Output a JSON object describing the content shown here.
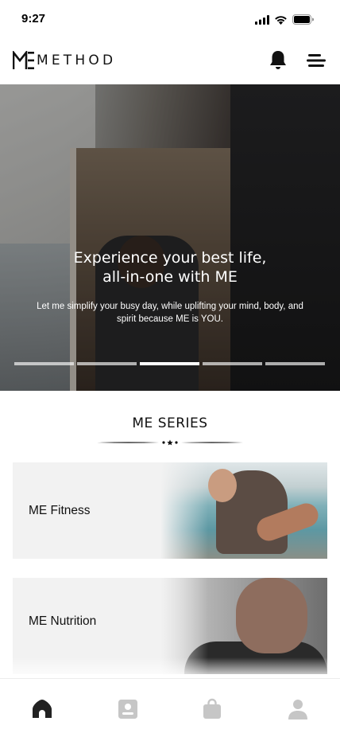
{
  "status_bar": {
    "time": "9:27",
    "icons": [
      "signal-icon",
      "wifi-icon",
      "battery-icon"
    ]
  },
  "header": {
    "logo_text": "METHOD",
    "icons": [
      "bell-icon",
      "menu-icon"
    ]
  },
  "hero": {
    "title_line1": "Experience your best life,",
    "title_line2": "all-in-one with ME",
    "subtitle": "Let me simplify your busy day, while uplifting your mind, body, and spirit because ME is YOU.",
    "slides_count": 5,
    "active_slide": 3
  },
  "section": {
    "title": "ME SERIES"
  },
  "cards": [
    {
      "label": "ME Fitness"
    },
    {
      "label": "ME Nutrition"
    }
  ],
  "bottom_nav": {
    "items": [
      "home-icon",
      "portrait-icon",
      "bag-icon",
      "profile-icon"
    ],
    "active": "home-icon"
  },
  "colors": {
    "text": "#111111",
    "card_bg": "#f2f2f2",
    "nav_active": "#222222",
    "nav_inactive": "#c6c6c6"
  }
}
